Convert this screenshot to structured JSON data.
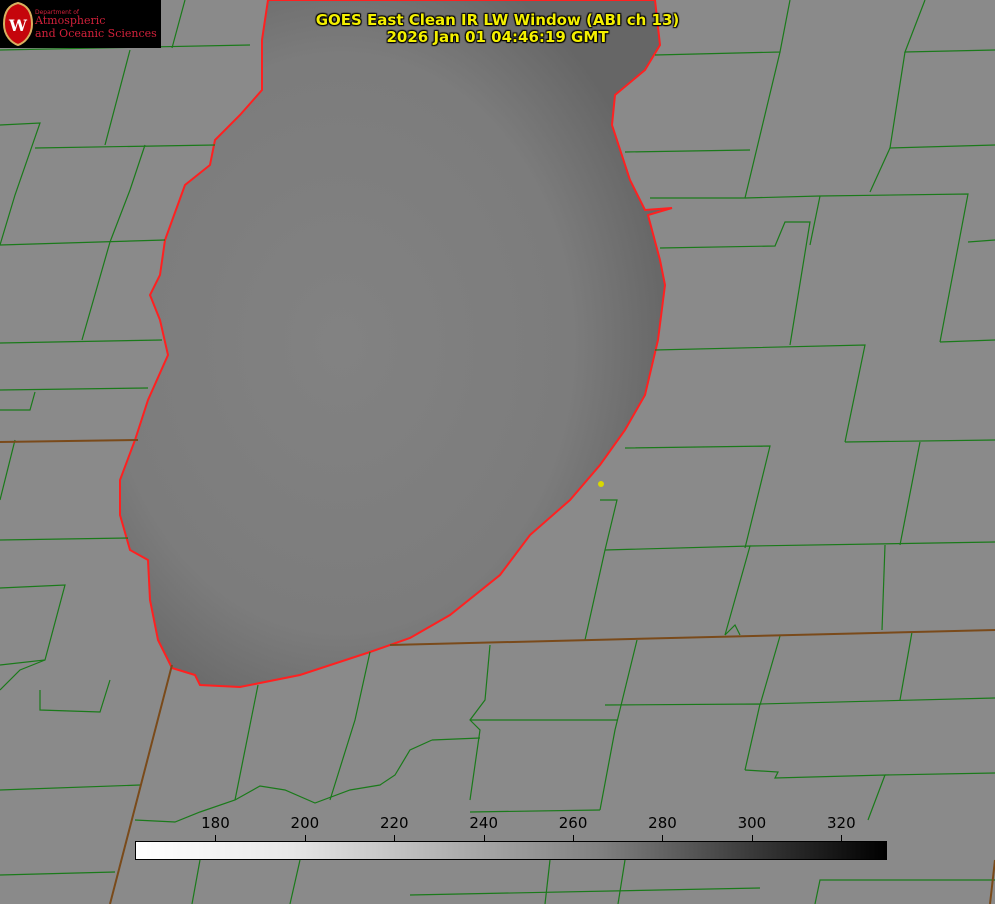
{
  "logo": {
    "department": "Department of",
    "line1": "Atmospheric",
    "line2": "and Oceanic Sciences",
    "crest_letter": "W"
  },
  "title": {
    "line1": "GOES East Clean IR LW Window (ABI ch 13)",
    "line2": "2026 Jan 01 04:46:19 GMT"
  },
  "colorbar": {
    "ticks": [
      "180",
      "200",
      "220",
      "240",
      "260",
      "280",
      "300",
      "320"
    ],
    "tick_values": [
      180,
      200,
      220,
      240,
      260,
      280,
      300,
      320
    ],
    "range": [
      162,
      330
    ],
    "colormap": "white-to-black"
  },
  "colors": {
    "county_lines": "#1a7a1a",
    "shoreline": "#ff2020",
    "title_text": "#f4f000",
    "background": "#8a8a8a",
    "lake": "#7a7a7a"
  }
}
